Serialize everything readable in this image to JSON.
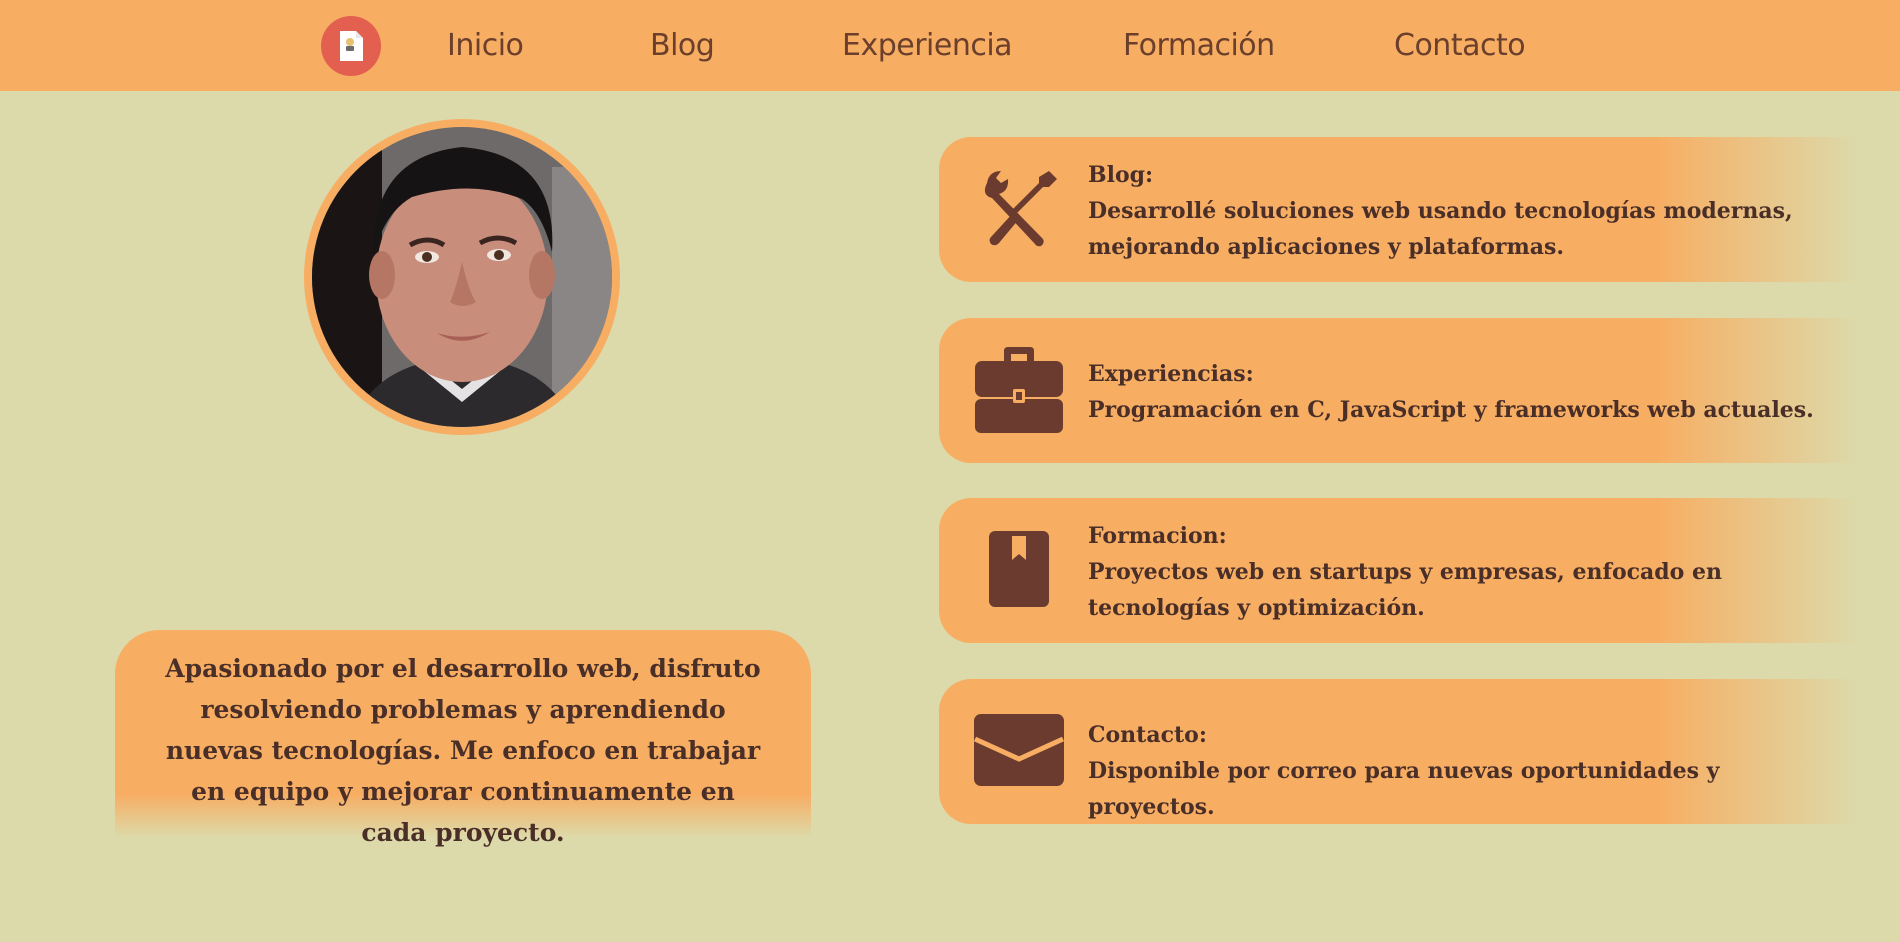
{
  "nav": {
    "logo_icon": "document-avatar-icon",
    "links": [
      "Inicio",
      "Blog",
      "Experiencia",
      "Formación",
      "Contacto"
    ]
  },
  "profile": {
    "photo_icon": "profile-photo"
  },
  "bio": {
    "text": "Apasionado por el desarrollo web, disfruto resolviendo problemas y aprendiendo nuevas tecnologías. Me enfoco en trabajar en equipo y mejorar continuamente en cada proyecto."
  },
  "cards": [
    {
      "icon": "tools-icon",
      "title": "Blog:",
      "text": "Desarrollé soluciones web usando tecnologías modernas, mejorando aplicaciones y plataformas."
    },
    {
      "icon": "briefcase-icon",
      "title": "Experiencias:",
      "text": "Programación en C, JavaScript y frameworks web actuales."
    },
    {
      "icon": "book-icon",
      "title": "Formacion:",
      "text": "Proyectos web en startups y empresas, enfocado en tecnologías y optimización."
    },
    {
      "icon": "envelope-icon",
      "title": "Contacto:",
      "text": "Disponible por correo para nuevas oportunidades y proyectos."
    }
  ],
  "colors": {
    "background": "#dcdaaa",
    "accent": "#f7ae63",
    "logo": "#e35f4f",
    "icon": "#6a3b2e",
    "text": "#4a2e28",
    "nav_text": "#6b3f2c"
  }
}
